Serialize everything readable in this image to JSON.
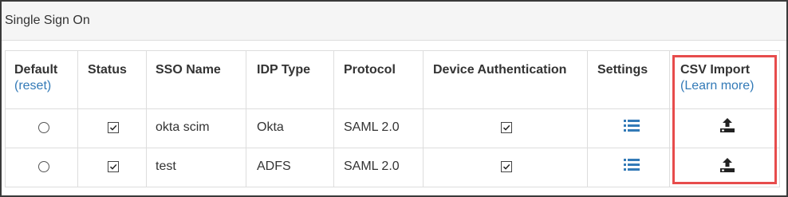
{
  "panel": {
    "title": "Single Sign On"
  },
  "columns": {
    "default": {
      "label": "Default",
      "sub": "(reset)"
    },
    "status": {
      "label": "Status"
    },
    "sso_name": {
      "label": "SSO Name"
    },
    "idp_type": {
      "label": "IDP Type"
    },
    "protocol": {
      "label": "Protocol"
    },
    "device_auth": {
      "label": "Device Authentication"
    },
    "settings": {
      "label": "Settings"
    },
    "csv_import": {
      "label": "CSV Import",
      "sub": "(Learn more)"
    }
  },
  "rows": [
    {
      "default_selected": false,
      "status_checked": true,
      "sso_name": "okta scim",
      "idp_type": "Okta",
      "protocol": "SAML 2.0",
      "device_auth_checked": true,
      "settings_icon": "list-icon",
      "csv_icon": "upload-icon"
    },
    {
      "default_selected": false,
      "status_checked": true,
      "sso_name": "test",
      "idp_type": "ADFS",
      "protocol": "SAML 2.0",
      "device_auth_checked": true,
      "settings_icon": "list-icon",
      "csv_icon": "upload-icon"
    }
  ],
  "colors": {
    "link": "#337ab7",
    "highlight": "#e74c4c",
    "border": "#dddddd"
  }
}
